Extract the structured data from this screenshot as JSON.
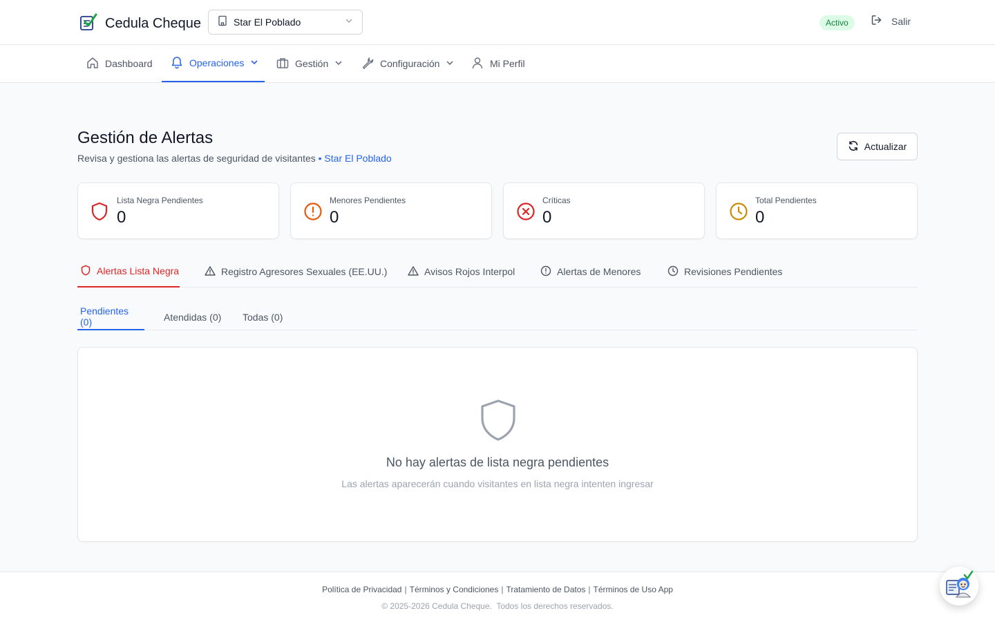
{
  "app": {
    "name": "Cedula Cheque",
    "status": "Activo",
    "logout_label": "Salir"
  },
  "site_selector": {
    "value": "Star El Poblado"
  },
  "nav": {
    "items": [
      {
        "label": "Dashboard",
        "icon": "home-icon"
      },
      {
        "label": "Operaciones",
        "icon": "bell-icon",
        "active": true,
        "dropdown": true
      },
      {
        "label": "Gestión",
        "icon": "briefcase-icon",
        "dropdown": true
      },
      {
        "label": "Configuración",
        "icon": "wrench-icon",
        "dropdown": true
      },
      {
        "label": "Mi Perfil",
        "icon": "user-icon"
      }
    ]
  },
  "page": {
    "title": "Gestión de Alertas",
    "subtitle": "Revisa y gestiona las alertas de seguridad de visitantes",
    "subtitle_site": "• Star El Poblado",
    "refresh_label": "Actualizar"
  },
  "stats": [
    {
      "label": "Lista Negra Pendientes",
      "value": "0",
      "icon": "shield-icon",
      "color": "#dc2626"
    },
    {
      "label": "Menores Pendientes",
      "value": "0",
      "icon": "alert-circle-icon",
      "color": "#ea580c"
    },
    {
      "label": "Críticas",
      "value": "0",
      "icon": "x-circle-icon",
      "color": "#dc2626"
    },
    {
      "label": "Total Pendientes",
      "value": "0",
      "icon": "clock-icon",
      "color": "#ca8a04"
    }
  ],
  "tabs": [
    {
      "label": "Alertas Lista Negra",
      "icon": "shield-icon",
      "active": true
    },
    {
      "label": "Registro Agresores Sexuales (EE.UU.)",
      "icon": "warning-triangle-icon"
    },
    {
      "label": "Avisos Rojos Interpol",
      "icon": "warning-triangle-icon"
    },
    {
      "label": "Alertas de Menores",
      "icon": "alert-circle-icon"
    },
    {
      "label": "Revisiones Pendientes",
      "icon": "clock-icon"
    }
  ],
  "subtabs": [
    {
      "label": "Pendientes (0)",
      "active": true
    },
    {
      "label": "Atendidas (0)"
    },
    {
      "label": "Todas (0)"
    }
  ],
  "empty_state": {
    "icon": "shield-icon",
    "title": "No hay alertas de lista negra pendientes",
    "description": "Las alertas aparecerán cuando visitantes en lista negra intenten ingresar"
  },
  "footer": {
    "links": [
      "Política de Privacidad",
      "Términos y Condiciones",
      "Tratamiento de Datos",
      "Términos de Uso App"
    ],
    "separator": "|",
    "copyright": "© 2025-2026 Cedula Cheque.  Todos los derechos reservados."
  },
  "colors": {
    "primary": "#2563eb",
    "danger": "#dc2626",
    "warning": "#ea580c",
    "amber": "#ca8a04",
    "success_bg": "#dcfce7",
    "success_text": "#15803d"
  }
}
